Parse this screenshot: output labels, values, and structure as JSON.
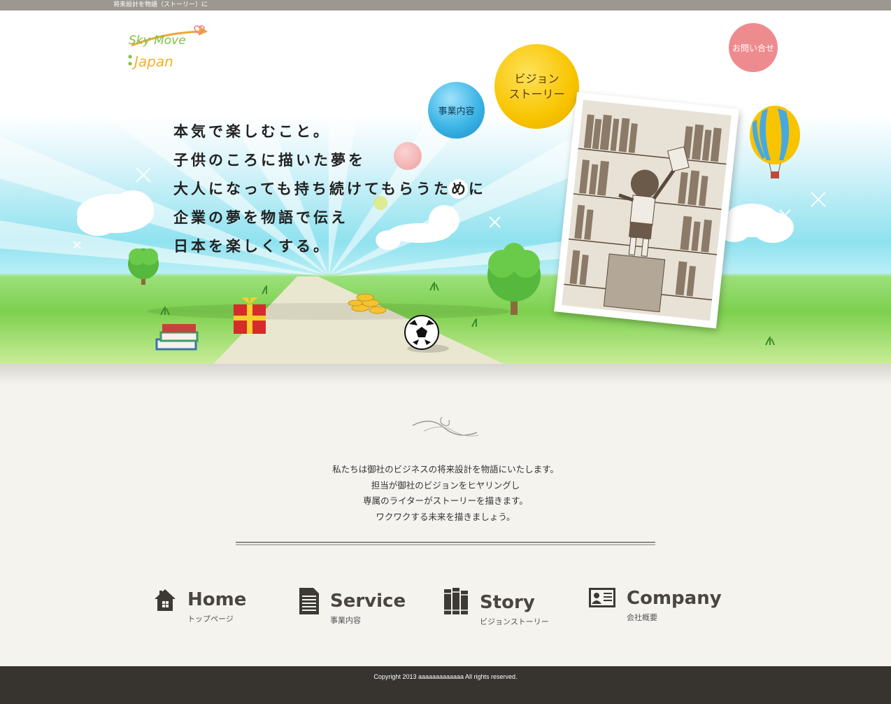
{
  "topbar": {
    "tagline": "将来設計を物語（ストーリー）に"
  },
  "logo": {
    "line1": "Sky Move",
    "line2": "Japan"
  },
  "hero": {
    "contact_label": "お問い合せ",
    "vision_label_1": "ビジョン",
    "vision_label_2": "ストーリー",
    "service_label": "事業内容",
    "copy_lines": [
      "本気で楽しむこと。",
      "子供のころに描いた夢を",
      "大人になっても持ち続けてもらうために",
      "企業の夢を物語で伝え",
      "日本を楽しくする。"
    ]
  },
  "intro": {
    "lines": [
      "私たちは御社のビジネスの将来設計を物語にいたします。",
      "担当が御社のビジョンをヒヤリングし",
      "専属のライターがストーリーを描きます。",
      "ワクワクする未来を描きましょう。"
    ]
  },
  "nav": [
    {
      "title": "Home",
      "sub": "トップページ",
      "icon": "house-icon"
    },
    {
      "title": "Service",
      "sub": "事業内容",
      "icon": "document-icon"
    },
    {
      "title": "Story",
      "sub": "ビジョンストーリー",
      "icon": "books-icon"
    },
    {
      "title": "Company",
      "sub": "会社概要",
      "icon": "id-card-icon"
    }
  ],
  "footer": {
    "copyright": "Copyright 2013 aaaaaaaaaaaaa All rights reserved."
  },
  "colors": {
    "topbar": "#9c9891",
    "contact_bubble": "#ee8b8e",
    "vision_bubble": "#f8c400",
    "service_bubble": "#3bb4e6",
    "footer": "#373430",
    "nav_text": "#4a4540"
  }
}
